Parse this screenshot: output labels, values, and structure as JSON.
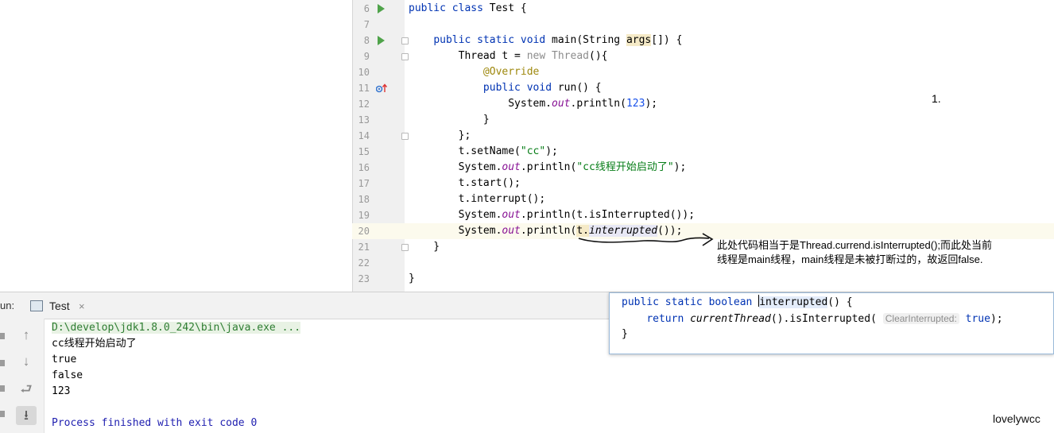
{
  "editor": {
    "lines": [
      {
        "n": "6",
        "tokens": [
          [
            "kw",
            "public class "
          ],
          [
            "",
            "Test {"
          ]
        ]
      },
      {
        "n": "7",
        "tokens": []
      },
      {
        "n": "8",
        "tokens": [
          [
            "",
            "    "
          ],
          [
            "kw",
            "public static void "
          ],
          [
            "",
            "main(String "
          ],
          [
            "hl",
            "args"
          ],
          [
            "",
            "[]) {"
          ]
        ]
      },
      {
        "n": "9",
        "tokens": [
          [
            "",
            "        Thread t = "
          ],
          [
            "gray",
            "new "
          ],
          [
            "gray",
            "Thread"
          ],
          [
            "",
            "(){"
          ]
        ]
      },
      {
        "n": "10",
        "tokens": [
          [
            "",
            "            "
          ],
          [
            "ann",
            "@Override"
          ]
        ]
      },
      {
        "n": "11",
        "tokens": [
          [
            "",
            "            "
          ],
          [
            "kw",
            "public void "
          ],
          [
            "",
            "run() {"
          ]
        ]
      },
      {
        "n": "12",
        "tokens": [
          [
            "",
            "                System."
          ],
          [
            "fld",
            "out"
          ],
          [
            "",
            ".println("
          ],
          [
            "num",
            "123"
          ],
          [
            "",
            ");"
          ]
        ]
      },
      {
        "n": "13",
        "tokens": [
          [
            "",
            "            }"
          ]
        ]
      },
      {
        "n": "14",
        "tokens": [
          [
            "",
            "        };"
          ]
        ]
      },
      {
        "n": "15",
        "tokens": [
          [
            "",
            "        t.setName("
          ],
          [
            "str",
            "\"cc\""
          ],
          [
            "",
            ");"
          ]
        ]
      },
      {
        "n": "16",
        "tokens": [
          [
            "",
            "        System."
          ],
          [
            "fld",
            "out"
          ],
          [
            "",
            ".println("
          ],
          [
            "str",
            "\"cc线程开始启动了\""
          ],
          [
            "",
            ");"
          ]
        ]
      },
      {
        "n": "17",
        "tokens": [
          [
            "",
            "        t.start();"
          ]
        ]
      },
      {
        "n": "18",
        "tokens": [
          [
            "",
            "        t.interrupt();"
          ]
        ]
      },
      {
        "n": "19",
        "tokens": [
          [
            "",
            "        System."
          ],
          [
            "fld",
            "out"
          ],
          [
            "",
            ".println(t.isInterrupted());"
          ]
        ]
      },
      {
        "n": "20",
        "tokens": [
          [
            "",
            "        System."
          ],
          [
            "fld",
            "out"
          ],
          [
            "",
            ".println("
          ],
          [
            "hl",
            "t."
          ],
          [
            "usage ital",
            "interrupted"
          ],
          [
            "",
            "());"
          ]
        ]
      },
      {
        "n": "21",
        "tokens": [
          [
            "",
            "    }"
          ]
        ]
      },
      {
        "n": "22",
        "tokens": []
      },
      {
        "n": "23",
        "tokens": [
          [
            "",
            "}"
          ]
        ]
      }
    ]
  },
  "annotations": {
    "note_number": "1.",
    "callout_line1": "此处代码相当于是Thread.currend.isInterrupted();而此处当前",
    "callout_line2": "线程是main线程，main线程是未被打断过的，故返回false."
  },
  "run_panel": {
    "label": "un:",
    "tab_label": "Test",
    "tab_close": "×",
    "tab_icon": "console-icon",
    "console": {
      "command": "D:\\develop\\jdk1.8.0_242\\bin\\java.exe ...",
      "output": [
        "cc线程开始启动了",
        "true",
        "false",
        "123",
        ""
      ],
      "exit": "Process finished with exit code 0"
    },
    "toolbar_icons": [
      "arrow-up-icon",
      "arrow-down-icon",
      "soft-wrap-icon",
      "scroll-to-end-icon"
    ]
  },
  "popup": {
    "line1_kw": "public static boolean ",
    "line1_name": "interrupted",
    "line1_rest": "() {",
    "line2_kw": "return ",
    "line2_call": "currentThread",
    "line2_mid": "().isInterrupted( ",
    "line2_hint": "ClearInterrupted:",
    "line2_val": " true",
    "line2_end": ");",
    "line3": "}"
  },
  "watermark": "lovelywcc",
  "colors": {
    "keyword": "#0033b3",
    "string": "#067d17",
    "number": "#1750eb",
    "annotation": "#9e880d",
    "field": "#871094",
    "run_green": "#4fa34a"
  }
}
